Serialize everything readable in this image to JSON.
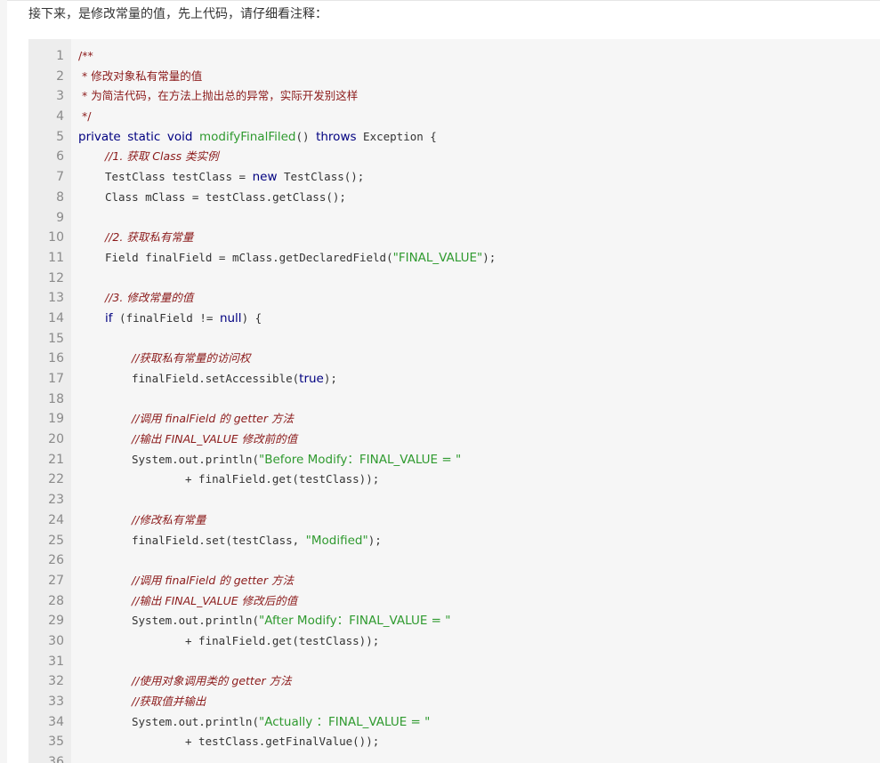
{
  "intro_text": "接下来，是修改常量的值，先上代码，请仔细看注释：",
  "code": {
    "lines": [
      {
        "n": "1",
        "indent": 0,
        "tokens": [
          {
            "t": "/**",
            "k": "doc"
          }
        ]
      },
      {
        "n": "2",
        "indent": 0,
        "tokens": [
          {
            "t": " * 修改对象私有常量的值",
            "k": "doc"
          }
        ]
      },
      {
        "n": "3",
        "indent": 0,
        "tokens": [
          {
            "t": " * 为简洁代码，在方法上抛出总的异常，实际开发别这样",
            "k": "doc"
          }
        ]
      },
      {
        "n": "4",
        "indent": 0,
        "tokens": [
          {
            "t": " */",
            "k": "doc"
          }
        ]
      },
      {
        "n": "5",
        "indent": 0,
        "tokens": [
          {
            "t": "private",
            "k": "kw"
          },
          {
            "t": " ",
            "k": "plain"
          },
          {
            "t": "static",
            "k": "kw"
          },
          {
            "t": " ",
            "k": "plain"
          },
          {
            "t": "void",
            "k": "kw"
          },
          {
            "t": " ",
            "k": "plain"
          },
          {
            "t": "modifyFinalFiled",
            "k": "method"
          },
          {
            "t": "() ",
            "k": "plain"
          },
          {
            "t": "throws",
            "k": "kw"
          },
          {
            "t": " Exception {",
            "k": "plain"
          }
        ]
      },
      {
        "n": "6",
        "indent": 1,
        "tokens": [
          {
            "t": "//1. 获取 Class 类实例",
            "k": "comment"
          }
        ]
      },
      {
        "n": "7",
        "indent": 1,
        "tokens": [
          {
            "t": "TestClass testClass = ",
            "k": "plain"
          },
          {
            "t": "new",
            "k": "kw"
          },
          {
            "t": " TestClass();",
            "k": "plain"
          }
        ]
      },
      {
        "n": "8",
        "indent": 1,
        "tokens": [
          {
            "t": "Class mClass = testClass.getClass();",
            "k": "plain"
          }
        ]
      },
      {
        "n": "9",
        "indent": 0,
        "tokens": []
      },
      {
        "n": "10",
        "indent": 1,
        "tokens": [
          {
            "t": "//2. 获取私有常量",
            "k": "comment"
          }
        ]
      },
      {
        "n": "11",
        "indent": 1,
        "tokens": [
          {
            "t": "Field finalField = mClass.getDeclaredField(",
            "k": "plain"
          },
          {
            "t": "\"FINAL_VALUE\"",
            "k": "string"
          },
          {
            "t": ");",
            "k": "plain"
          }
        ]
      },
      {
        "n": "12",
        "indent": 0,
        "tokens": []
      },
      {
        "n": "13",
        "indent": 1,
        "tokens": [
          {
            "t": "//3. 修改常量的值",
            "k": "comment"
          }
        ]
      },
      {
        "n": "14",
        "indent": 1,
        "tokens": [
          {
            "t": "if",
            "k": "kw"
          },
          {
            "t": " (finalField != ",
            "k": "plain"
          },
          {
            "t": "null",
            "k": "kw"
          },
          {
            "t": ") {",
            "k": "plain"
          }
        ]
      },
      {
        "n": "15",
        "indent": 0,
        "tokens": []
      },
      {
        "n": "16",
        "indent": 2,
        "tokens": [
          {
            "t": "//获取私有常量的访问权",
            "k": "comment"
          }
        ]
      },
      {
        "n": "17",
        "indent": 2,
        "tokens": [
          {
            "t": "finalField.setAccessible(",
            "k": "plain"
          },
          {
            "t": "true",
            "k": "kw"
          },
          {
            "t": ");",
            "k": "plain"
          }
        ]
      },
      {
        "n": "18",
        "indent": 0,
        "tokens": []
      },
      {
        "n": "19",
        "indent": 2,
        "tokens": [
          {
            "t": "//调用 finalField 的 getter 方法",
            "k": "comment"
          }
        ]
      },
      {
        "n": "20",
        "indent": 2,
        "tokens": [
          {
            "t": "//输出 FINAL_VALUE 修改前的值",
            "k": "comment"
          }
        ]
      },
      {
        "n": "21",
        "indent": 2,
        "tokens": [
          {
            "t": "System.out.println(",
            "k": "plain"
          },
          {
            "t": "\"Before Modify：FINAL_VALUE = \"",
            "k": "string"
          }
        ]
      },
      {
        "n": "22",
        "indent": 4,
        "tokens": [
          {
            "t": "+ finalField.get(testClass));",
            "k": "plain"
          }
        ]
      },
      {
        "n": "23",
        "indent": 0,
        "tokens": []
      },
      {
        "n": "24",
        "indent": 2,
        "tokens": [
          {
            "t": "//修改私有常量",
            "k": "comment"
          }
        ]
      },
      {
        "n": "25",
        "indent": 2,
        "tokens": [
          {
            "t": "finalField.set(testClass, ",
            "k": "plain"
          },
          {
            "t": "\"Modified\"",
            "k": "string"
          },
          {
            "t": ");",
            "k": "plain"
          }
        ]
      },
      {
        "n": "26",
        "indent": 0,
        "tokens": []
      },
      {
        "n": "27",
        "indent": 2,
        "tokens": [
          {
            "t": "//调用 finalField 的 getter 方法",
            "k": "comment"
          }
        ]
      },
      {
        "n": "28",
        "indent": 2,
        "tokens": [
          {
            "t": "//输出 FINAL_VALUE 修改后的值",
            "k": "comment"
          }
        ]
      },
      {
        "n": "29",
        "indent": 2,
        "tokens": [
          {
            "t": "System.out.println(",
            "k": "plain"
          },
          {
            "t": "\"After Modify：FINAL_VALUE = \"",
            "k": "string"
          }
        ]
      },
      {
        "n": "30",
        "indent": 4,
        "tokens": [
          {
            "t": "+ finalField.get(testClass));",
            "k": "plain"
          }
        ]
      },
      {
        "n": "31",
        "indent": 0,
        "tokens": []
      },
      {
        "n": "32",
        "indent": 2,
        "tokens": [
          {
            "t": "//使用对象调用类的 getter 方法",
            "k": "comment"
          }
        ]
      },
      {
        "n": "33",
        "indent": 2,
        "tokens": [
          {
            "t": "//获取值并输出",
            "k": "comment"
          }
        ]
      },
      {
        "n": "34",
        "indent": 2,
        "tokens": [
          {
            "t": "System.out.println(",
            "k": "plain"
          },
          {
            "t": "\"Actually ：FINAL_VALUE = \"",
            "k": "string"
          }
        ]
      },
      {
        "n": "35",
        "indent": 4,
        "tokens": [
          {
            "t": "+ testClass.getFinalValue());",
            "k": "plain"
          }
        ]
      },
      {
        "n": "36",
        "indent": 0,
        "tokens": []
      }
    ]
  },
  "colors": {
    "comment": "#8b1a1a",
    "keyword": "#000080",
    "method": "#2f9a2f",
    "string": "#2f9a2f",
    "line_number": "#8a8a8a",
    "code_background": "#f6f6f6",
    "gutter_background": "#ededed"
  }
}
